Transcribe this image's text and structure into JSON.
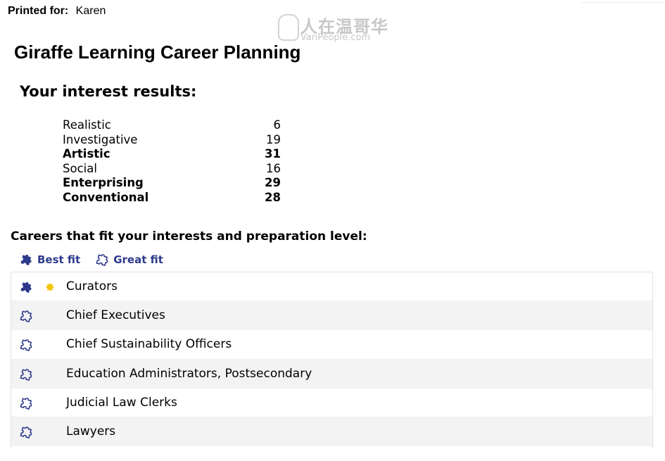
{
  "header": {
    "printed_for_label": "Printed for:",
    "printed_for_name": "Karen"
  },
  "watermark": {
    "chinese": "人在温哥华",
    "site": "VanPeople.com"
  },
  "title": "Giraffe Learning Career Planning",
  "interest_results": {
    "heading": "Your interest results:",
    "scores": [
      {
        "name": "Realistic",
        "value": "6",
        "bold": false
      },
      {
        "name": "Investigative",
        "value": "19",
        "bold": false
      },
      {
        "name": "Artistic",
        "value": "31",
        "bold": true
      },
      {
        "name": "Social",
        "value": "16",
        "bold": false
      },
      {
        "name": "Enterprising",
        "value": "29",
        "bold": true
      },
      {
        "name": "Conventional",
        "value": "28",
        "bold": true
      }
    ]
  },
  "careers": {
    "heading": "Careers that fit your interests and preparation level:",
    "legend": {
      "best_fit": "Best fit",
      "great_fit": "Great fit"
    },
    "items": [
      {
        "name": "Curators",
        "fit": "best",
        "highlight": true
      },
      {
        "name": "Chief Executives",
        "fit": "great",
        "highlight": false
      },
      {
        "name": "Chief Sustainability Officers",
        "fit": "great",
        "highlight": false
      },
      {
        "name": "Education Administrators, Postsecondary",
        "fit": "great",
        "highlight": false
      },
      {
        "name": "Judicial Law Clerks",
        "fit": "great",
        "highlight": false
      },
      {
        "name": "Lawyers",
        "fit": "great",
        "highlight": false
      }
    ]
  },
  "colors": {
    "icon": "#2e3a8c",
    "star": "#f5c400",
    "row_alt": "#f3f3f3"
  },
  "icons": {
    "best_fit": "puzzle-solid-icon",
    "great_fit": "puzzle-outline-icon",
    "highlight": "star-burst-icon"
  }
}
